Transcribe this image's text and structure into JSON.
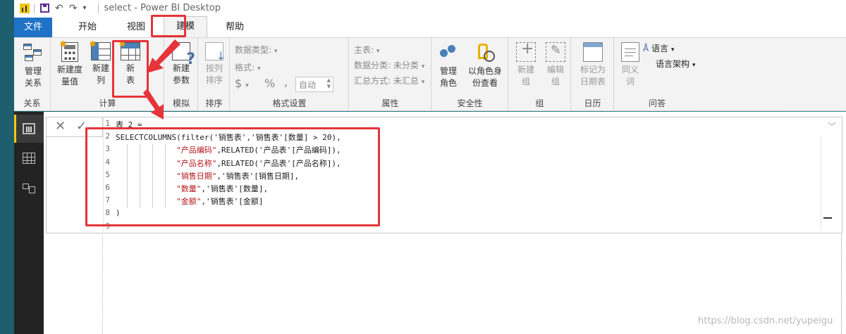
{
  "window": {
    "title": "select - Power BI Desktop"
  },
  "menu": {
    "file": "文件",
    "tabs": [
      "开始",
      "视图",
      "建模",
      "帮助"
    ]
  },
  "ribbon": {
    "relationships": {
      "button": "管理\n关系",
      "group": "关系"
    },
    "calculations": {
      "new_measure": "新建度\n量值",
      "new_column": "新建\n列",
      "new_table": "新\n表",
      "group": "计算"
    },
    "whatif": {
      "new_parameter": "新建\n参数",
      "group": "模拟"
    },
    "sort": {
      "sort_by_column": "按列\n排序",
      "group": "排序"
    },
    "formatting": {
      "data_type": "数据类型:",
      "format": "格式:",
      "currency": "$",
      "percent": "%",
      "comma": ",",
      "auto": "自动",
      "group": "格式设置"
    },
    "properties": {
      "home_table": "主表:",
      "data_category": "数据分类: 未分类",
      "summarization": "汇总方式: 未汇总",
      "group": "属性"
    },
    "security": {
      "manage_roles": "管理\n角色",
      "view_as": "以角色身\n份查看",
      "group": "安全性"
    },
    "groups": {
      "new_group": "新建\n组",
      "edit_groups": "编辑\n组",
      "group": "组"
    },
    "calendars": {
      "mark_as_date": "标记为\n日期表",
      "group": "日历"
    },
    "qa": {
      "synonyms": "同义\n词",
      "language": "语言",
      "linguistic_schema": "语言架构",
      "group": "问答"
    }
  },
  "formula": {
    "lines": [
      {
        "n": "1",
        "parts": [
          {
            "t": "表 2 =",
            "s": false
          }
        ]
      },
      {
        "n": "2",
        "parts": [
          {
            "t": "SELECTCOLUMNS(filter('销售表','销售表'[数量] > 20),",
            "s": false
          }
        ]
      },
      {
        "n": "3",
        "parts": [
          {
            "t": "             ",
            "s": false
          },
          {
            "t": "\"产品编码\"",
            "s": true
          },
          {
            "t": ",RELATED('产品表'[产品编码]),",
            "s": false
          }
        ]
      },
      {
        "n": "4",
        "parts": [
          {
            "t": "             ",
            "s": false
          },
          {
            "t": "\"产品名称\"",
            "s": true
          },
          {
            "t": ",RELATED('产品表'[产品名称]),",
            "s": false
          }
        ]
      },
      {
        "n": "5",
        "parts": [
          {
            "t": "             ",
            "s": false
          },
          {
            "t": "\"销售日期\"",
            "s": true
          },
          {
            "t": ",'销售表'[销售日期],",
            "s": false
          }
        ]
      },
      {
        "n": "6",
        "parts": [
          {
            "t": "             ",
            "s": false
          },
          {
            "t": "\"数量\"",
            "s": true
          },
          {
            "t": ",'销售表'[数量],",
            "s": false
          }
        ]
      },
      {
        "n": "7",
        "parts": [
          {
            "t": "             ",
            "s": false
          },
          {
            "t": "\"金额\"",
            "s": true
          },
          {
            "t": ",'销售表'[金额]",
            "s": false
          }
        ]
      },
      {
        "n": "8",
        "parts": [
          {
            "t": ")",
            "s": false
          }
        ]
      },
      {
        "n": "9",
        "parts": [
          {
            "t": "",
            "s": false
          }
        ]
      }
    ]
  },
  "watermark": "https://blog.csdn.net/yupeigu",
  "colors": {
    "annotation_red": "#e5343a",
    "file_tab_blue": "#1f72c6",
    "string_red": "#b5171a"
  }
}
